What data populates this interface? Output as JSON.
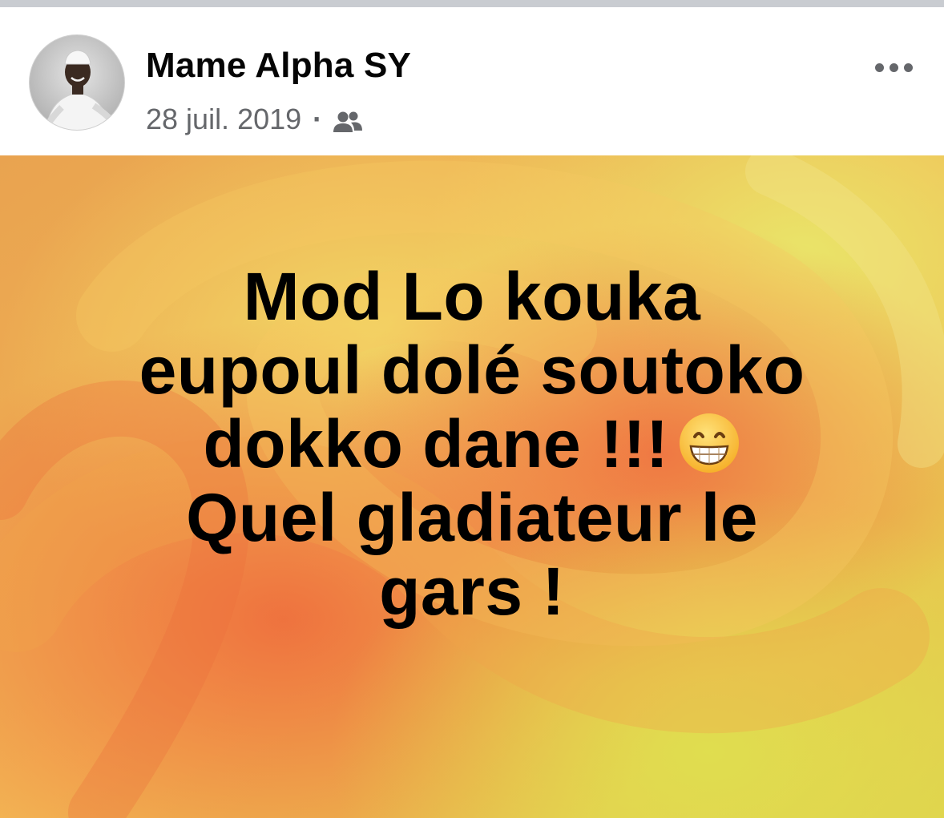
{
  "post": {
    "author": {
      "name": "Mame Alpha SY",
      "avatar_icon": "profile-photo"
    },
    "date": "28 juil. 2019",
    "separator": "·",
    "audience_icon": "friends-icon",
    "more_icon": "more-options-icon",
    "text_lines": [
      "Mod Lo kouka",
      "eupoul dolé soutoko",
      "dokko dane !!!",
      "Quel gladiateur le",
      "gars !"
    ],
    "emoji": "grinning-face-with-smiling-eyes-emoji",
    "background_theme": "orange-yellow-gradient"
  },
  "colors": {
    "author": "#050505",
    "meta": "#65676b",
    "post_text": "#000000",
    "bg_orange": "#f29a3e",
    "bg_yellow": "#e8d84a",
    "bg_red": "#e9603a"
  }
}
